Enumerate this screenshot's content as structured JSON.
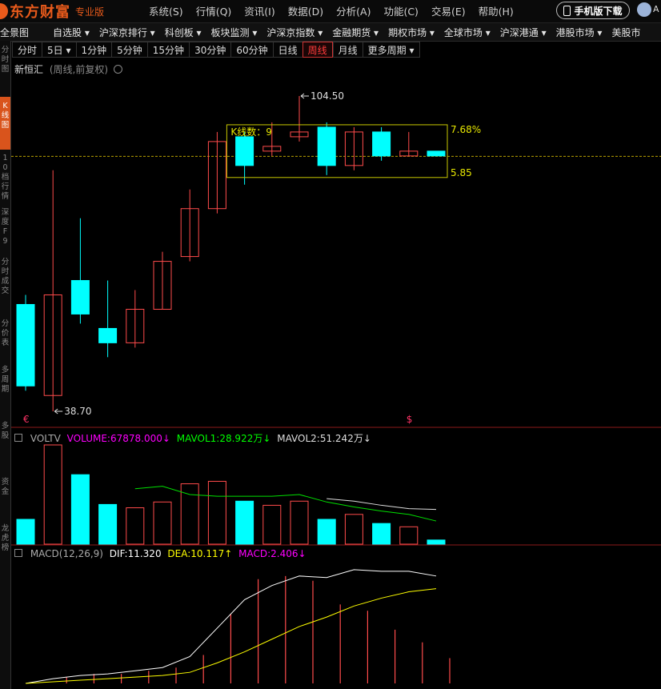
{
  "app": {
    "logo_text": "东方财富",
    "logo_sub": "专业版",
    "menu": [
      "系统(S)",
      "行情(Q)",
      "资讯(I)",
      "数据(D)",
      "分析(A)",
      "功能(C)",
      "交易(E)",
      "帮助(H)"
    ],
    "mobile_button": "手机版下载",
    "avatar_text": "A"
  },
  "nav": [
    "全景图",
    "自选股 ▾",
    "沪深京排行 ▾",
    "科创板 ▾",
    "板块监测 ▾",
    "沪深京指数 ▾",
    "金融期货 ▾",
    "期权市场 ▾",
    "全球市场 ▾",
    "沪深港通 ▾",
    "港股市场 ▾",
    "美股市"
  ],
  "left_strip": [
    {
      "label": "分时图",
      "active": false
    },
    {
      "label": "K线图",
      "active": true
    },
    {
      "label": "10档行情",
      "active": false
    },
    {
      "label": "深度F9",
      "active": false
    },
    {
      "label": "分时成交",
      "active": false
    },
    {
      "label": "分价表",
      "active": false
    },
    {
      "label": "多周期",
      "active": false
    },
    {
      "label": "多股",
      "active": false
    },
    {
      "label": "资金",
      "active": false
    },
    {
      "label": "龙虎榜",
      "active": false
    }
  ],
  "periods": [
    {
      "label": "分时",
      "active": false
    },
    {
      "label": "5日 ▾",
      "active": false
    },
    {
      "label": "1分钟",
      "active": false
    },
    {
      "label": "5分钟",
      "active": false
    },
    {
      "label": "15分钟",
      "active": false
    },
    {
      "label": "30分钟",
      "active": false
    },
    {
      "label": "60分钟",
      "active": false
    },
    {
      "label": "日线",
      "active": false
    },
    {
      "label": "周线",
      "active": true
    },
    {
      "label": "月线",
      "active": false
    },
    {
      "label": "更多周期 ▾",
      "active": false
    }
  ],
  "stock": {
    "name": "新恒汇",
    "mode": "(周线,前复权)",
    "settings_icon": "gear-icon"
  },
  "annotations": {
    "high_label": "104.50",
    "low_label": "38.70",
    "box_count_label": "K线数：9",
    "box_pct_label": "7.68%",
    "box_low_label": "5.85",
    "marker_left": "€",
    "marker_right": "$"
  },
  "volume_panel": {
    "name": "VOLTV",
    "volume": "VOLUME:67878.000",
    "mavol1": "MAVOL1:28.922万",
    "mavol2": "MAVOL2:51.242万",
    "arrow_down": "↓"
  },
  "macd_panel": {
    "name": "MACD(12,26,9)",
    "dif": "DIF:11.320",
    "dea": "DEA:10.117",
    "macd": "MACD:2.406",
    "arrow_up": "↑",
    "arrow_down": "↓"
  },
  "colors": {
    "up": "#ff4b4b",
    "down": "#00ffff",
    "accent": "#e85a1b",
    "box": "#c8c800",
    "volume_label": "#ff00ff",
    "mavol1": "#00ff00",
    "dea_line": "#ffff00",
    "dif_line": "#ffffff"
  },
  "chart_data": {
    "type": "candlestick",
    "price_labels": {
      "high": 104.5,
      "low": 38.7
    },
    "candles": [
      {
        "open": 61,
        "close": 44,
        "high": 63,
        "low": 43,
        "dir": "down"
      },
      {
        "open": 42,
        "close": 63,
        "high": 89,
        "low": 38.7,
        "dir": "up"
      },
      {
        "open": 66,
        "close": 59,
        "high": 79,
        "low": 57,
        "dir": "down"
      },
      {
        "open": 56,
        "close": 53,
        "high": 66,
        "low": 50,
        "dir": "down"
      },
      {
        "open": 53,
        "close": 60,
        "high": 64,
        "low": 52,
        "dir": "up"
      },
      {
        "open": 60,
        "close": 70,
        "high": 72,
        "low": 60,
        "dir": "up"
      },
      {
        "open": 71,
        "close": 81,
        "high": 85,
        "low": 70,
        "dir": "up"
      },
      {
        "open": 81,
        "close": 95,
        "high": 97,
        "low": 80,
        "dir": "up"
      },
      {
        "open": 96,
        "close": 90,
        "high": 97,
        "low": 86,
        "dir": "down"
      },
      {
        "open": 93,
        "close": 94,
        "high": 99,
        "low": 92,
        "dir": "up"
      },
      {
        "open": 96,
        "close": 97,
        "high": 104.5,
        "low": 95,
        "dir": "up"
      },
      {
        "open": 98,
        "close": 90,
        "high": 99,
        "low": 88,
        "dir": "down"
      },
      {
        "open": 90,
        "close": 97,
        "high": 98,
        "low": 89,
        "dir": "up"
      },
      {
        "open": 97,
        "close": 92,
        "high": 98,
        "low": 91,
        "dir": "down"
      },
      {
        "open": 92,
        "close": 93,
        "high": 97,
        "low": 92,
        "dir": "up"
      },
      {
        "open": 93,
        "close": 92,
        "high": 93,
        "low": 92,
        "dir": "down"
      }
    ],
    "volume": {
      "values": [
        30,
        120,
        84,
        48,
        44,
        51,
        73,
        76,
        52,
        47,
        52,
        30,
        36,
        25,
        21,
        5
      ],
      "dir": [
        "down",
        "up",
        "down",
        "down",
        "up",
        "up",
        "up",
        "up",
        "down",
        "up",
        "up",
        "down",
        "up",
        "down",
        "up",
        "down"
      ],
      "mavol1": [
        null,
        null,
        null,
        null,
        67,
        70,
        60,
        58,
        58,
        58,
        60,
        51,
        45,
        40,
        36,
        28
      ],
      "mavol2": [
        null,
        null,
        null,
        null,
        null,
        null,
        null,
        null,
        null,
        null,
        null,
        55,
        52,
        47,
        43,
        42
      ]
    },
    "macd": {
      "dif": [
        0,
        3,
        5,
        6,
        8,
        10,
        17,
        35,
        53,
        62,
        68,
        67,
        72,
        71,
        71,
        68
      ],
      "dea": [
        0,
        1,
        2,
        3,
        4,
        5,
        7,
        13,
        20,
        28,
        36,
        42,
        49,
        54,
        58,
        60
      ],
      "hist": [
        0,
        4,
        6,
        6,
        8,
        10,
        18,
        44,
        66,
        68,
        65,
        50,
        46,
        34,
        26,
        16
      ]
    }
  }
}
